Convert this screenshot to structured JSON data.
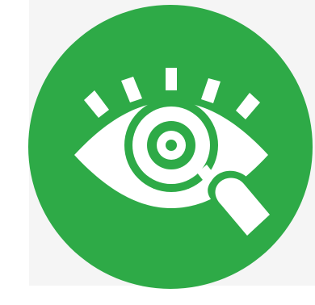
{
  "icon": {
    "name": "eye-inspection-icon",
    "circle_color": "#2eaa47",
    "glyph_color": "#ffffff",
    "panel_color": "#f5f5f5"
  }
}
